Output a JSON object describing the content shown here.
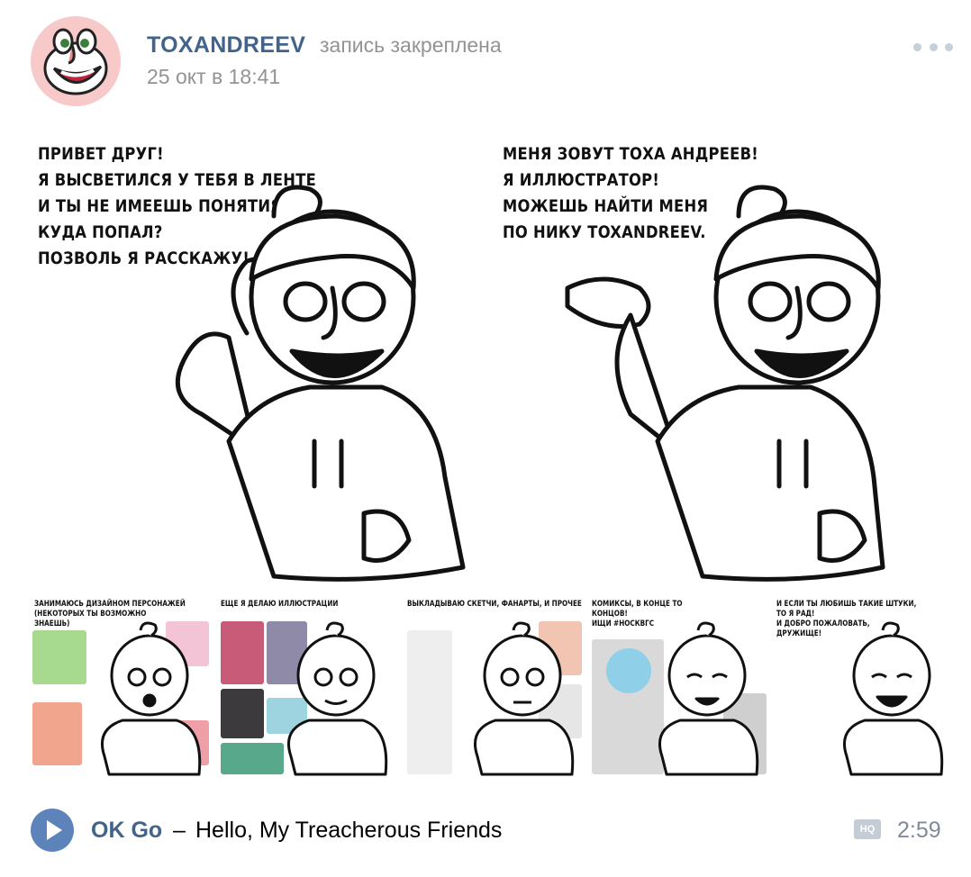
{
  "post": {
    "author": "TOXANDREEV",
    "pinned_label": "запись закреплена",
    "date": "25 окт в 18:41",
    "avatar_icon": "cartoon-face-avatar",
    "more_icon": "more-dots-icon"
  },
  "images": {
    "main": [
      {
        "caption": "ПРИВЕТ ДРУГ!\nЯ ВЫСВЕТИЛСЯ У ТЕБЯ В ЛЕНТЕ\nИ ТЫ НЕ ИМЕЕШЬ ПОНЯТИЯ\nКУДА ПОПАЛ?\nПОЗВОЛЬ Я РАССКАЖУ!"
      },
      {
        "caption": "МЕНЯ ЗОВУТ ТОХА АНДРЕЕВ!\nЯ ИЛЛЮСТРАТОР!\nМОЖЕШЬ НАЙТИ МЕНЯ\nПО НИКУ TOXANDREEV."
      }
    ],
    "thumbs": [
      {
        "caption": "ЗАНИМАЮСЬ ДИЗАЙНОМ ПЕРСОНАЖЕЙ\n(НЕКОТОРЫХ ТЫ ВОЗМОЖНО\nЗНАЕШЬ)"
      },
      {
        "caption": "ЕЩЕ Я ДЕЛАЮ ИЛЛЮСТРАЦИИ"
      },
      {
        "caption": "ВЫКЛАДЫВАЮ СКЕТЧИ, ФАНАРТЫ, И ПРОЧЕЕ"
      },
      {
        "caption": "КОМИКСЫ, В КОНЦЕ ТО\nКОНЦОВ!\nИЩИ #НОСКВГС"
      },
      {
        "caption": "И ЕСЛИ ТЫ ЛЮБИШЬ ТАКИЕ ШТУКИ,\nТО Я РАД!\nИ ДОБРО ПОЖАЛОВАТЬ,\nДРУЖИЩЕ!"
      }
    ]
  },
  "audio": {
    "artist": "OK Go",
    "separator": "–",
    "title": "Hello, My Treacherous Friends",
    "hq_badge": "HQ",
    "duration": "2:59",
    "play_icon": "play-icon",
    "accent": "#5d84ba"
  }
}
